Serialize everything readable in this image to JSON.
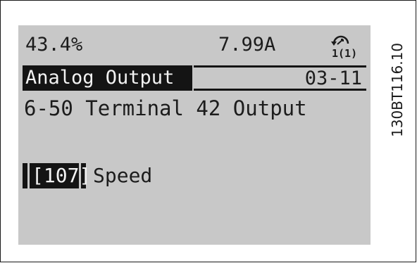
{
  "display": {
    "status": {
      "load_percent": "43.4%",
      "current": "7.99A",
      "menu_indicator": "1(1)",
      "menu_icon": "rotate-arrow-icon"
    },
    "title_bar": {
      "group_name": "Analog Output",
      "group_code": "03-11"
    },
    "parameter": "6-50 Terminal 42 Output",
    "selected_value": {
      "code": "[107]",
      "label": "Speed"
    }
  },
  "figure_id": "130BT116.10",
  "colors": {
    "lcd_background": "#c8c8c8",
    "lcd_text": "#1c1c1c",
    "highlight": "#141414"
  }
}
